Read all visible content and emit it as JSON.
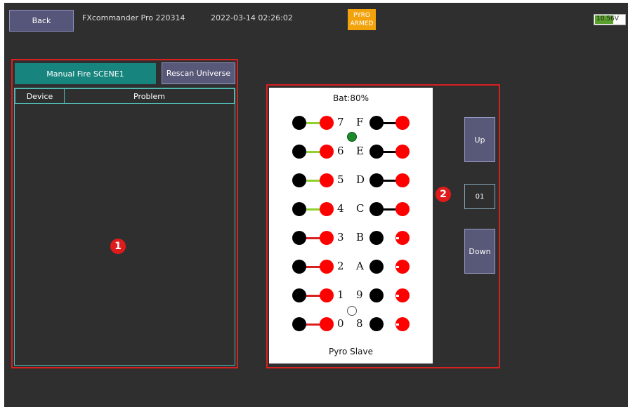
{
  "header": {
    "back_label": "Back",
    "title": "FXcommander Pro 220314",
    "datetime": "2022-03-14 02:26:02",
    "pyro_line1": "PYRO",
    "pyro_line2": "ARMED",
    "battery_voltage": "10.56V",
    "battery_level": 0.6
  },
  "annotations": {
    "badge1": "1",
    "badge2": "2"
  },
  "left_panel": {
    "manual_fire_label": "Manual Fire SCENE1",
    "rescan_label": "Rescan Universe",
    "columns": [
      "Device",
      "Problem"
    ]
  },
  "slave_panel": {
    "battery_label": "Bat:80%",
    "footer_label": "Pyro Slave",
    "left_channels": [
      {
        "label": "7",
        "state": "green"
      },
      {
        "label": "6",
        "state": "green"
      },
      {
        "label": "5",
        "state": "green"
      },
      {
        "label": "4",
        "state": "green"
      },
      {
        "label": "3",
        "state": "red"
      },
      {
        "label": "2",
        "state": "red"
      },
      {
        "label": "1",
        "state": "red"
      },
      {
        "label": "0",
        "state": "red"
      }
    ],
    "right_channels": [
      {
        "label": "F",
        "state": "connected"
      },
      {
        "label": "E",
        "state": "connected"
      },
      {
        "label": "D",
        "state": "connected"
      },
      {
        "label": "C",
        "state": "connected"
      },
      {
        "label": "B",
        "state": "open"
      },
      {
        "label": "A",
        "state": "open"
      },
      {
        "label": "9",
        "state": "open"
      },
      {
        "label": "8",
        "state": "open"
      }
    ]
  },
  "nav": {
    "up_label": "Up",
    "page_value": "01",
    "down_label": "Down"
  },
  "colors": {
    "green": "#8ed12c",
    "red": "#d8201f",
    "black": "#000000",
    "teal": "#17857e"
  }
}
